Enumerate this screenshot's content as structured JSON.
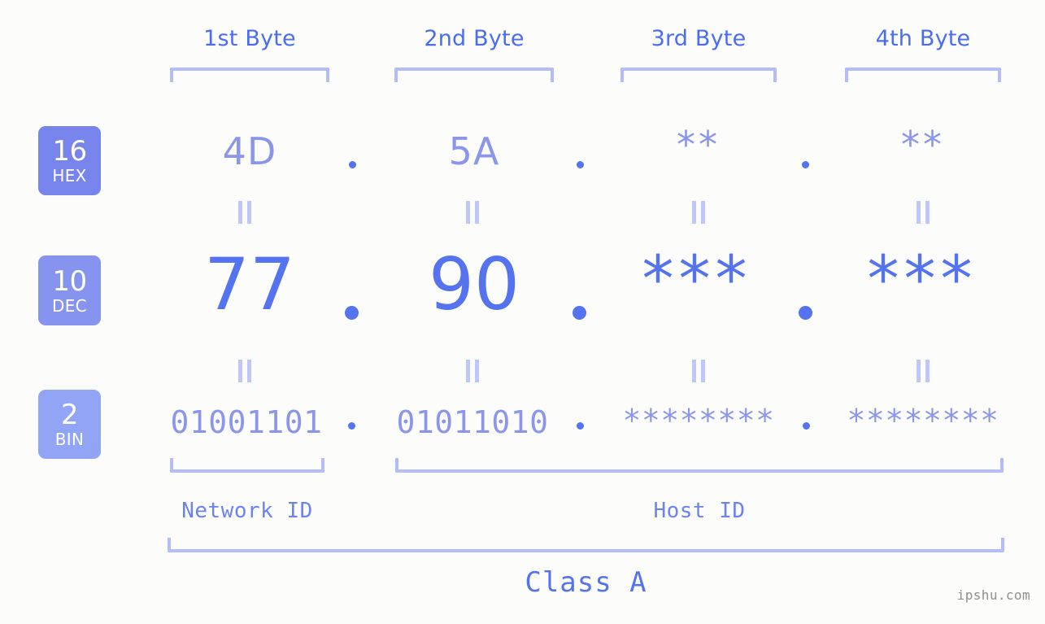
{
  "meta": {
    "background_color": "#fcfdfa",
    "accent_strong": "#5572ef",
    "accent_mid": "#8b96ea",
    "accent_light": "#b4bdf9",
    "watermark": "ipshu.com"
  },
  "headers": [
    {
      "label": "1st Byte"
    },
    {
      "label": "2nd Byte"
    },
    {
      "label": "3rd Byte"
    },
    {
      "label": "4th Byte"
    }
  ],
  "radix_badges": [
    {
      "number": "16",
      "name": "HEX",
      "color": "#7684ec"
    },
    {
      "number": "10",
      "name": "DEC",
      "color": "#8794ef"
    },
    {
      "number": "2",
      "name": "BIN",
      "color": "#92a4f6"
    }
  ],
  "rows": {
    "hex": {
      "radix": "16",
      "radix_name": "HEX",
      "values": [
        "4D",
        "5A",
        "**",
        "**"
      ]
    },
    "dec": {
      "radix": "10",
      "radix_name": "DEC",
      "values": [
        "77",
        "90",
        "***",
        "***"
      ]
    },
    "bin": {
      "radix": "2",
      "radix_name": "BIN",
      "values": [
        "01001101",
        "01011010",
        "********",
        "********"
      ]
    }
  },
  "separators": {
    "hex_dots": [
      ".",
      ".",
      "."
    ],
    "dec_dots": [
      ".",
      ".",
      "."
    ],
    "bin_dots": [
      ".",
      ".",
      "."
    ]
  },
  "equality_marks": {
    "glyph": "||",
    "count_per_row": 4
  },
  "sections": [
    {
      "label": "Network ID"
    },
    {
      "label": "Host ID"
    }
  ],
  "class_label": "Class A",
  "address": {
    "hex": "4D.5A.**.**",
    "dec": "77.90.***.***",
    "bin": "01001101.01011010.********.********",
    "class": "Class A",
    "network_id_bytes": 1,
    "host_id_bytes": 3
  }
}
